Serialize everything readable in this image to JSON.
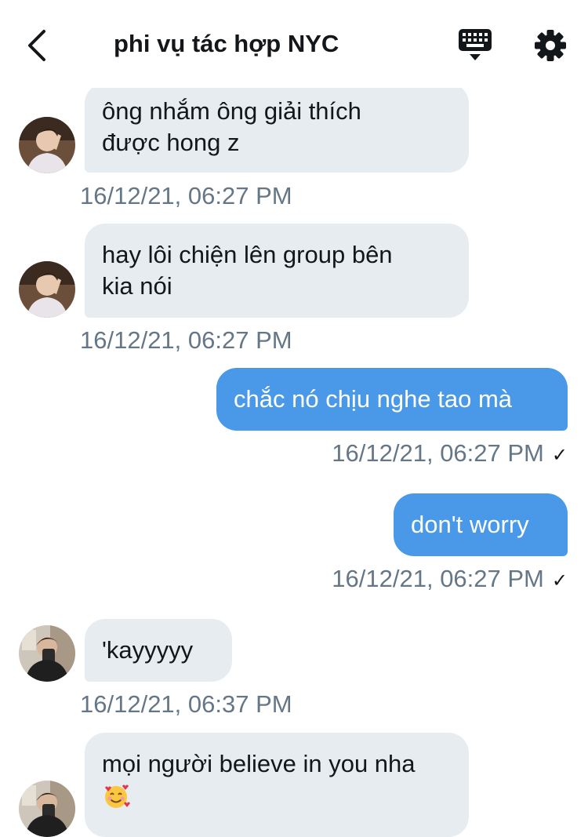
{
  "header": {
    "title": "phi vụ tác hợp NYC",
    "back_icon": "chevron-left-icon",
    "keyboard_icon": "keyboard-icon",
    "settings_icon": "gear-icon"
  },
  "messages": [
    {
      "direction": "in",
      "lines": [
        "ông nhắm ông giải thích",
        "được hong z"
      ],
      "timestamp": "16/12/21, 06:27 PM"
    },
    {
      "direction": "in",
      "lines": [
        "hay lôi chiện lên group bên",
        "kia nói"
      ],
      "timestamp": "16/12/21, 06:27 PM"
    },
    {
      "direction": "out",
      "lines": [
        "chắc nó chịu nghe tao mà"
      ],
      "timestamp": "16/12/21, 06:27 PM",
      "read_mark": "✓"
    },
    {
      "direction": "out",
      "lines": [
        "don't worry"
      ],
      "timestamp": "16/12/21, 06:27 PM",
      "read_mark": "✓"
    },
    {
      "direction": "in",
      "lines": [
        "'kayyyyy"
      ],
      "timestamp": "16/12/21, 06:37 PM"
    },
    {
      "direction": "in",
      "lines": [
        "mọi người believe in you nha"
      ],
      "emoji": "smiling-face-with-hearts",
      "timestamp": ""
    }
  ],
  "colors": {
    "outgoing_bubble": "#4a99e9",
    "incoming_bubble": "#e6ecf0",
    "timestamp": "#657786"
  }
}
